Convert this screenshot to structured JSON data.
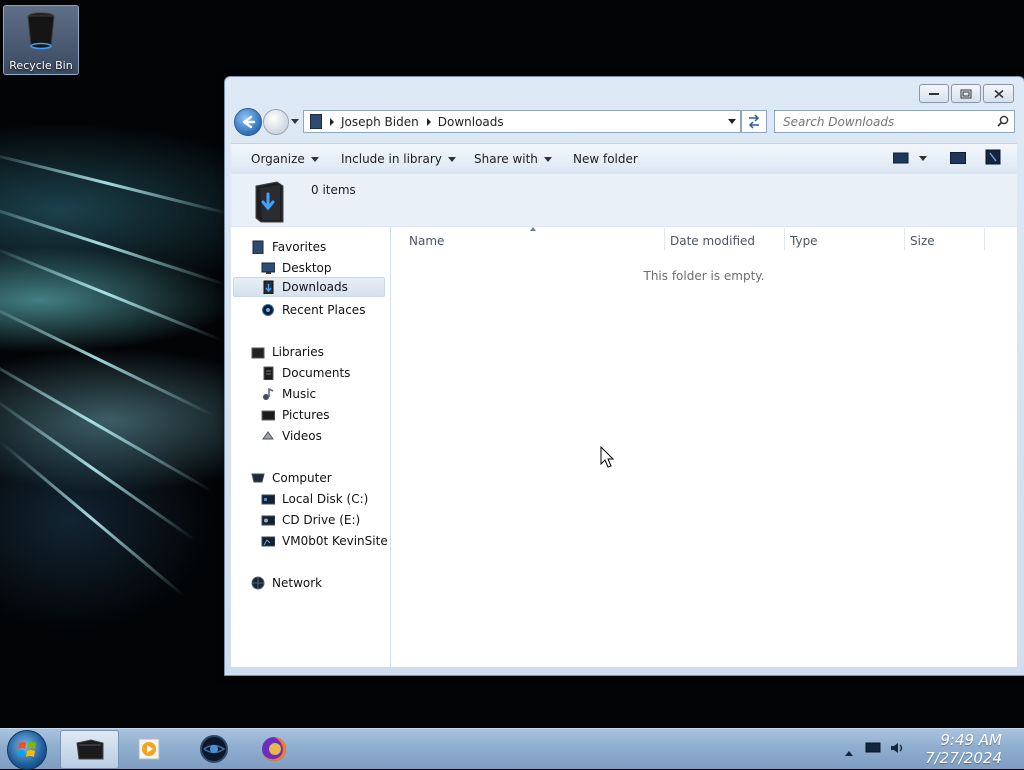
{
  "desktop": {
    "icons": [
      {
        "label": "Recycle Bin",
        "icon": "recycle-bin-icon"
      }
    ]
  },
  "window": {
    "caption_buttons": [
      "minimize",
      "restore",
      "close"
    ],
    "address": {
      "breadcrumbs": [
        "Joseph Biden",
        "Downloads"
      ]
    },
    "search": {
      "placeholder": "Search Downloads"
    },
    "toolbar": {
      "organize": "Organize",
      "include_in_library": "Include in library",
      "share_with": "Share with",
      "new_folder": "New folder"
    },
    "details": {
      "item_count": "0 items"
    },
    "nav_pane": {
      "favorites": {
        "label": "Favorites",
        "items": [
          "Desktop",
          "Downloads",
          "Recent Places"
        ],
        "selected": "Downloads"
      },
      "libraries": {
        "label": "Libraries",
        "items": [
          "Documents",
          "Music",
          "Pictures",
          "Videos"
        ]
      },
      "computer": {
        "label": "Computer",
        "items": [
          "Local Disk (C:)",
          "CD Drive (E:)",
          "VM0b0t KevinSite"
        ]
      },
      "network": {
        "label": "Network"
      }
    },
    "content": {
      "columns": [
        "Name",
        "Date modified",
        "Type",
        "Size"
      ],
      "empty_message": "This folder is empty."
    }
  },
  "taskbar": {
    "pinned": [
      "windows-explorer-icon",
      "media-player-icon",
      "globe-browser-icon",
      "firefox-icon"
    ],
    "active": "windows-explorer-icon",
    "clock": {
      "time": "9:49 AM",
      "date": "7/27/2024"
    }
  },
  "colors": {
    "window_frame": "#dde9f5",
    "taskbar": "#8faecf",
    "accent_blue": "#2c6fb7"
  }
}
